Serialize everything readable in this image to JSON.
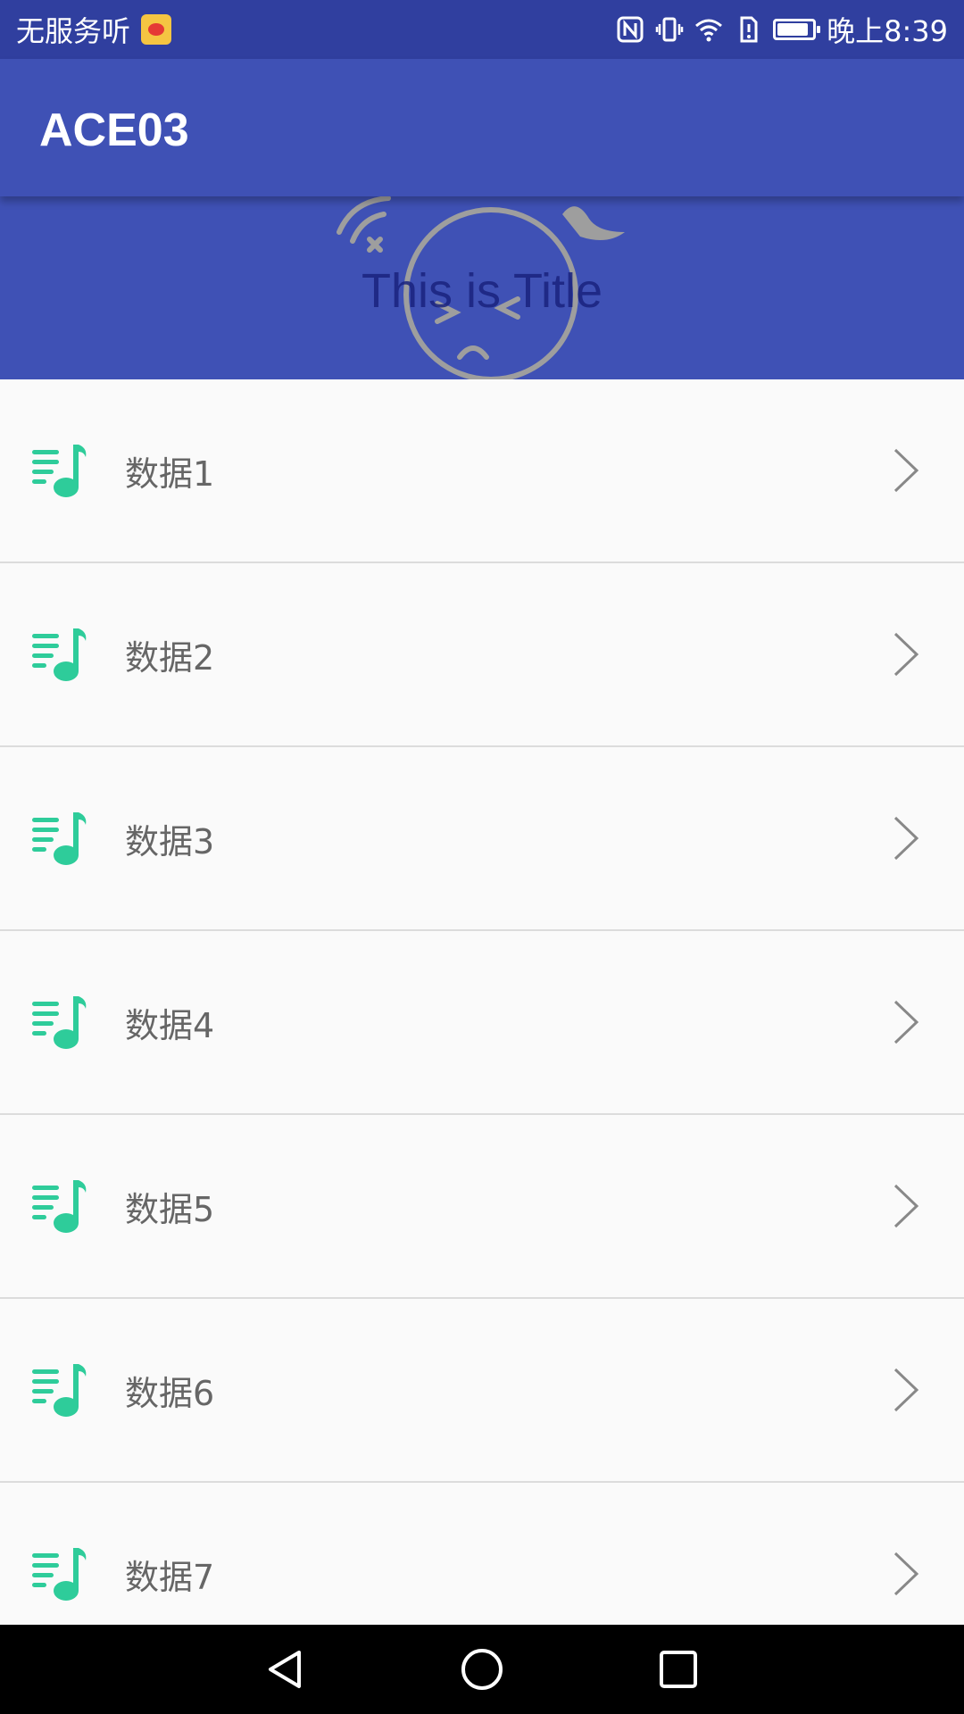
{
  "status_bar": {
    "carrier": "无服务听",
    "time": "晚上8:39",
    "icons": [
      "weibo-icon",
      "nfc-icon",
      "vibrate-icon",
      "wifi-icon",
      "sim-alert-icon",
      "battery-icon"
    ]
  },
  "app_bar": {
    "title": "ACE03"
  },
  "banner": {
    "title": "This is Title"
  },
  "list": {
    "items": [
      {
        "label": "数据1",
        "icon": "music-list-icon"
      },
      {
        "label": "数据2",
        "icon": "music-list-icon"
      },
      {
        "label": "数据3",
        "icon": "music-list-icon"
      },
      {
        "label": "数据4",
        "icon": "music-list-icon"
      },
      {
        "label": "数据5",
        "icon": "music-list-icon"
      },
      {
        "label": "数据6",
        "icon": "music-list-icon"
      },
      {
        "label": "数据7",
        "icon": "music-list-icon"
      }
    ]
  },
  "colors": {
    "primary": "#3f51b5",
    "primary_dark": "#303f9f",
    "accent_icon": "#2ecc9a"
  },
  "nav_bar": {
    "buttons": [
      "back-icon",
      "home-icon",
      "recents-icon"
    ]
  }
}
